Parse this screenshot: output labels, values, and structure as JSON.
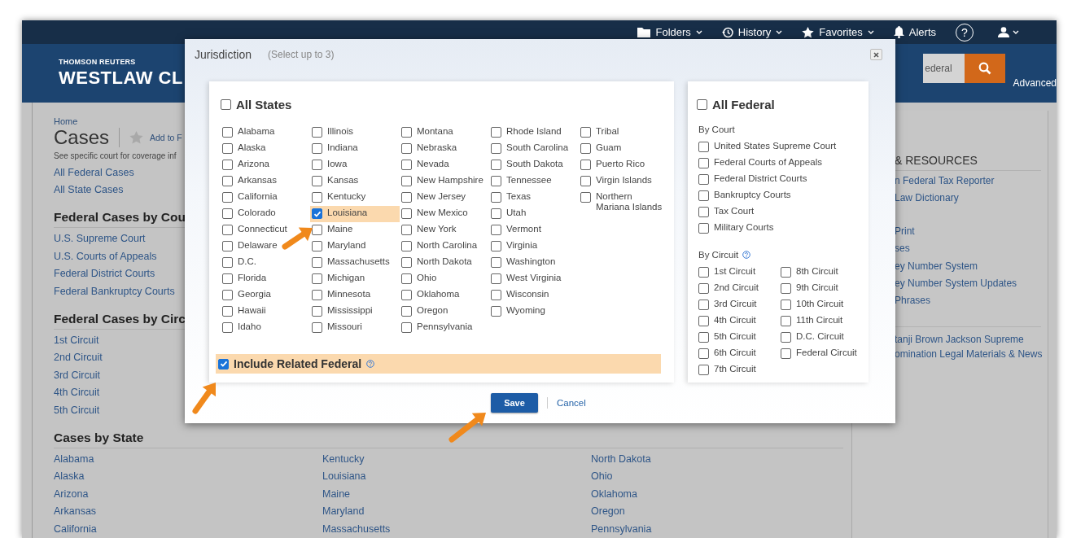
{
  "top_nav": [
    {
      "kind": "folder",
      "label": "Folders",
      "menu": true
    },
    {
      "kind": "history",
      "label": "History",
      "menu": true
    },
    {
      "kind": "star",
      "label": "Favorites",
      "menu": true
    },
    {
      "kind": "bell",
      "label": "Alerts",
      "menu": false
    }
  ],
  "help_button": {
    "label": "?"
  },
  "user_menu": {
    "menu": true
  },
  "header": {
    "brand_top": "THOMSON REUTERS",
    "brand": "WESTLAW CL",
    "search_value": "ederal",
    "advanced_link": "Advanced"
  },
  "page": {
    "breadcrumb": "Home",
    "title": "Cases",
    "favorite_link": "Add to F",
    "coverage_note": "See specific court for coverage inf",
    "links": [
      "All Federal Cases",
      "All State Cases"
    ],
    "sections": [
      {
        "heading": "Federal Cases by Cou",
        "links": [
          "U.S. Supreme Court",
          "U.S. Courts of Appeals",
          "Federal District Courts",
          "Federal Bankruptcy Courts"
        ]
      },
      {
        "heading": "Federal Cases by Circ",
        "links": [
          "1st Circuit",
          "2nd Circuit",
          "3rd Circuit",
          "4th Circuit",
          "5th Circuit"
        ]
      }
    ]
  },
  "cases_by_state": {
    "heading": "Cases by State",
    "columns": [
      [
        "Alabama",
        "Alaska",
        "Arizona",
        "Arkansas",
        "California"
      ],
      [
        "Kentucky",
        "Louisiana",
        "Maine",
        "Maryland",
        "Massachusetts"
      ],
      [
        "North Dakota",
        "Ohio",
        "Oklahoma",
        "Oregon",
        "Pennsylvania"
      ]
    ]
  },
  "right_panel": {
    "heading": "& RESOURCES",
    "groups": [
      [
        "n Federal Tax Reporter",
        "Law Dictionary"
      ],
      [
        "Print",
        "ses",
        "ey Number System",
        "ey Number System Updates",
        "Phrases"
      ],
      [
        "tanji Brown Jackson Supreme",
        "omination Legal Materials & News"
      ]
    ]
  },
  "dialog": {
    "title": "Jurisdiction",
    "hint": "(Select up to 3)",
    "all_states": {
      "label": "All States",
      "checked": false
    },
    "state_columns": [
      [
        {
          "label": "Alabama",
          "checked": false
        },
        {
          "label": "Alaska",
          "checked": false
        },
        {
          "label": "Arizona",
          "checked": false
        },
        {
          "label": "Arkansas",
          "checked": false
        },
        {
          "label": "California",
          "checked": false
        },
        {
          "label": "Colorado",
          "checked": false
        },
        {
          "label": "Connecticut",
          "checked": false
        },
        {
          "label": "Delaware",
          "checked": false
        },
        {
          "label": "D.C.",
          "checked": false
        },
        {
          "label": "Florida",
          "checked": false
        },
        {
          "label": "Georgia",
          "checked": false
        },
        {
          "label": "Hawaii",
          "checked": false
        },
        {
          "label": "Idaho",
          "checked": false
        }
      ],
      [
        {
          "label": "Illinois",
          "checked": false
        },
        {
          "label": "Indiana",
          "checked": false
        },
        {
          "label": "Iowa",
          "checked": false
        },
        {
          "label": "Kansas",
          "checked": false
        },
        {
          "label": "Kentucky",
          "checked": false
        },
        {
          "label": "Louisiana",
          "checked": true
        },
        {
          "label": "Maine",
          "checked": false
        },
        {
          "label": "Maryland",
          "checked": false
        },
        {
          "label": "Massachusetts",
          "checked": false
        },
        {
          "label": "Michigan",
          "checked": false
        },
        {
          "label": "Minnesota",
          "checked": false
        },
        {
          "label": "Mississippi",
          "checked": false
        },
        {
          "label": "Missouri",
          "checked": false
        }
      ],
      [
        {
          "label": "Montana",
          "checked": false
        },
        {
          "label": "Nebraska",
          "checked": false
        },
        {
          "label": "Nevada",
          "checked": false
        },
        {
          "label": "New Hampshire",
          "checked": false
        },
        {
          "label": "New Jersey",
          "checked": false
        },
        {
          "label": "New Mexico",
          "checked": false
        },
        {
          "label": "New York",
          "checked": false
        },
        {
          "label": "North Carolina",
          "checked": false
        },
        {
          "label": "North Dakota",
          "checked": false
        },
        {
          "label": "Ohio",
          "checked": false
        },
        {
          "label": "Oklahoma",
          "checked": false
        },
        {
          "label": "Oregon",
          "checked": false
        },
        {
          "label": "Pennsylvania",
          "checked": false
        }
      ],
      [
        {
          "label": "Rhode Island",
          "checked": false
        },
        {
          "label": "South Carolina",
          "checked": false
        },
        {
          "label": "South Dakota",
          "checked": false
        },
        {
          "label": "Tennessee",
          "checked": false
        },
        {
          "label": "Texas",
          "checked": false
        },
        {
          "label": "Utah",
          "checked": false
        },
        {
          "label": "Vermont",
          "checked": false
        },
        {
          "label": "Virginia",
          "checked": false
        },
        {
          "label": "Washington",
          "checked": false
        },
        {
          "label": "West Virginia",
          "checked": false
        },
        {
          "label": "Wisconsin",
          "checked": false
        },
        {
          "label": "Wyoming",
          "checked": false
        }
      ],
      [
        {
          "label": "Tribal",
          "checked": false
        },
        {
          "label": "Guam",
          "checked": false
        },
        {
          "label": "Puerto Rico",
          "checked": false
        },
        {
          "label": "Virgin Islands",
          "checked": false
        },
        {
          "label": "Northern Mariana Islands",
          "checked": false
        }
      ]
    ],
    "include_related": {
      "label": "Include Related Federal",
      "checked": true
    },
    "all_federal": {
      "label": "All Federal",
      "checked": false
    },
    "by_court": {
      "heading": "By Court",
      "items": [
        {
          "label": "United States Supreme Court",
          "checked": false
        },
        {
          "label": "Federal Courts of Appeals",
          "checked": false
        },
        {
          "label": "Federal District Courts",
          "checked": false
        },
        {
          "label": "Bankruptcy Courts",
          "checked": false
        },
        {
          "label": "Tax Court",
          "checked": false
        },
        {
          "label": "Military Courts",
          "checked": false
        }
      ]
    },
    "by_circuit": {
      "heading": "By Circuit",
      "columns": [
        [
          {
            "label": "1st Circuit",
            "checked": false
          },
          {
            "label": "2nd Circuit",
            "checked": false
          },
          {
            "label": "3rd Circuit",
            "checked": false
          },
          {
            "label": "4th Circuit",
            "checked": false
          },
          {
            "label": "5th Circuit",
            "checked": false
          },
          {
            "label": "6th Circuit",
            "checked": false
          },
          {
            "label": "7th Circuit",
            "checked": false
          }
        ],
        [
          {
            "label": "8th Circuit",
            "checked": false
          },
          {
            "label": "9th Circuit",
            "checked": false
          },
          {
            "label": "10th Circuit",
            "checked": false
          },
          {
            "label": "11th Circuit",
            "checked": false
          },
          {
            "label": "D.C. Circuit",
            "checked": false
          },
          {
            "label": "Federal Circuit",
            "checked": false
          }
        ]
      ]
    },
    "save": "Save",
    "cancel": "Cancel"
  }
}
